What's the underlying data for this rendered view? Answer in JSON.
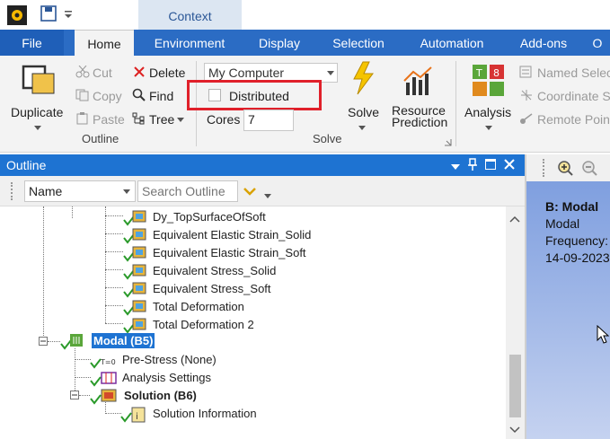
{
  "context_tab": "Context",
  "tabs": [
    {
      "label": "File"
    },
    {
      "label": "Home"
    },
    {
      "label": "Environment"
    },
    {
      "label": "Display"
    },
    {
      "label": "Selection"
    },
    {
      "label": "Automation"
    },
    {
      "label": "Add-ons"
    },
    {
      "label": "O"
    }
  ],
  "ribbon": {
    "duplicate": "Duplicate",
    "cut": "Cut",
    "copy": "Copy",
    "paste": "Paste",
    "delete": "Delete",
    "find": "Find",
    "tree": "Tree",
    "outline_group": "Outline",
    "computer_select": "My Computer",
    "distributed": "Distributed",
    "cores_label": "Cores",
    "cores_value": "7",
    "solve": "Solve",
    "resource_prediction_1": "Resource",
    "resource_prediction_2": "Prediction",
    "solve_group": "Solve",
    "analysis": "Analysis",
    "named_selection": "Named Selec",
    "coordinate_system": "Coordinate S",
    "remote_point": "Remote Poin"
  },
  "outline": {
    "title": "Outline",
    "name_filter": "Name",
    "search_placeholder": "Search Outline"
  },
  "tree_items": [
    {
      "label": "Dy_TopSurfaceOfSoft"
    },
    {
      "label": "Equivalent Elastic Strain_Solid"
    },
    {
      "label": "Equivalent Elastic Strain_Soft"
    },
    {
      "label": "Equivalent Stress_Solid"
    },
    {
      "label": "Equivalent Stress_Soft"
    },
    {
      "label": "Total Deformation"
    },
    {
      "label": "Total Deformation 2"
    },
    {
      "label": "Modal (B5)"
    },
    {
      "label": "Pre-Stress (None)"
    },
    {
      "label": "Analysis Settings"
    },
    {
      "label": "Solution (B6)"
    },
    {
      "label": "Solution Information"
    }
  ],
  "viewer": {
    "title": "B: Modal",
    "line1": "Modal",
    "line2": "Frequency:",
    "line3": "14-09-2023"
  },
  "colors": {
    "accent": "#2b6cc4",
    "outline_header": "#1e73d2",
    "highlight": "#e0202a"
  }
}
